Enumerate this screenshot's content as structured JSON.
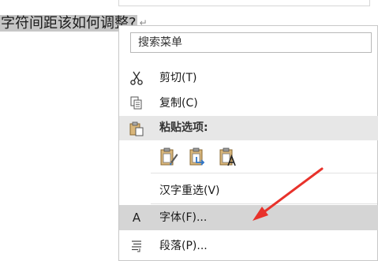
{
  "document": {
    "text_selected": "字符间距该如何调整?",
    "paragraph_mark": "↵"
  },
  "context_menu": {
    "search_placeholder": "搜索菜单",
    "cut": "剪切(T)",
    "copy": "复制(C)",
    "paste_options": "粘贴选项:",
    "reselect_hanzi": "汉字重选(V)",
    "font": "字体(F)...",
    "paragraph": "段落(P)..."
  },
  "icons": {
    "cut": "scissors-icon",
    "copy": "copy-icon",
    "paste": "clipboard-icon",
    "paste_keep_format": "paste-keep-formatting-icon",
    "paste_merge": "paste-merge-formatting-icon",
    "paste_text_only": "paste-text-only-icon",
    "font": "font-a-icon",
    "paragraph": "paragraph-icon",
    "annotation_arrow": "red-arrow-icon"
  },
  "colors": {
    "hover_bg": "#d5d5d5",
    "header_bg": "#e7e7e7",
    "annotation": "#e8322b",
    "paste_blue": "#2e75c9"
  }
}
